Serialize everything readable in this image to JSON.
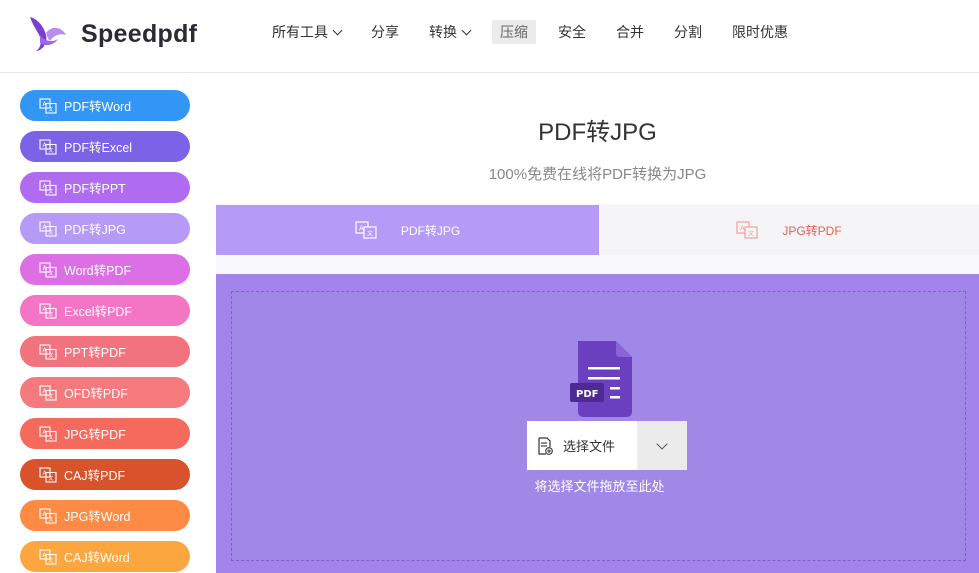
{
  "header": {
    "brand": "Speedpdf",
    "nav": [
      {
        "label": "所有工具",
        "dropdown": true,
        "active": false
      },
      {
        "label": "分享",
        "dropdown": false,
        "active": false
      },
      {
        "label": "转换",
        "dropdown": true,
        "active": false
      },
      {
        "label": "压缩",
        "dropdown": false,
        "active": true
      },
      {
        "label": "安全",
        "dropdown": false,
        "active": false
      },
      {
        "label": "合并",
        "dropdown": false,
        "active": false
      },
      {
        "label": "分割",
        "dropdown": false,
        "active": false
      },
      {
        "label": "限时优惠",
        "dropdown": false,
        "active": false
      }
    ]
  },
  "sidebar": {
    "items": [
      {
        "label": "PDF转Word",
        "color": "#3396f7"
      },
      {
        "label": "PDF转Excel",
        "color": "#7a63e6"
      },
      {
        "label": "PDF转PPT",
        "color": "#b06cf0"
      },
      {
        "label": "PDF转JPG",
        "color": "#b59af7"
      },
      {
        "label": "Word转PDF",
        "color": "#dd6fe4"
      },
      {
        "label": "Excel转PDF",
        "color": "#f376c4"
      },
      {
        "label": "PPT转PDF",
        "color": "#f2727d"
      },
      {
        "label": "OFD转PDF",
        "color": "#f47a7e"
      },
      {
        "label": "JPG转PDF",
        "color": "#f66a5e"
      },
      {
        "label": "CAJ转PDF",
        "color": "#d8522c"
      },
      {
        "label": "JPG转Word",
        "color": "#fd8a45"
      },
      {
        "label": "CAJ转Word",
        "color": "#fca640"
      }
    ]
  },
  "main": {
    "title": "PDF转JPG",
    "subtitle": "100%免费在线将PDF转换为JPG",
    "tabs": [
      {
        "label": "PDF转JPG",
        "active": true
      },
      {
        "label": "JPG转PDF",
        "active": false
      }
    ],
    "upload": {
      "icon_label": "PDF",
      "select_label": "选择文件",
      "hint": "将选择文件拖放至此处"
    }
  }
}
